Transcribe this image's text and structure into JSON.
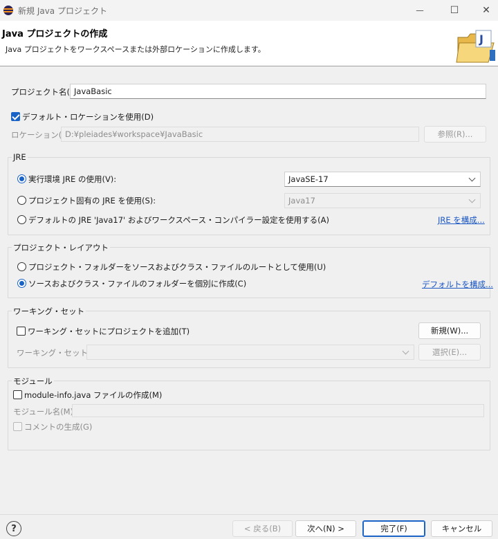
{
  "window": {
    "title": "新規 Java プロジェクト",
    "minimize_glyph": "—",
    "maximize_glyph": "☐",
    "close_glyph": "✕"
  },
  "header": {
    "title": "Java プロジェクトの作成",
    "description": "Java プロジェクトをワークスペースまたは外部ロケーションに作成します。",
    "icon": "folder-icon"
  },
  "project": {
    "name_label": "プロジェクト名(P):",
    "name_value": "JavaBasic",
    "default_location_label": "デフォルト・ロケーションを使用(D)",
    "default_location_checked": true,
    "location_label": "ロケーション(L):",
    "location_value": "D:¥pleiades¥workspace¥JavaBasic",
    "browse_label": "参照(R)..."
  },
  "jre": {
    "group_title": "JRE",
    "option_env_label": "実行環境 JRE の使用(V):",
    "option_env_value": "JavaSE-17",
    "option_project_label": "プロジェクト固有の JRE を使用(S):",
    "option_project_value": "Java17",
    "option_default_label": "デフォルトの JRE 'Java17' およびワークスペース・コンパイラー設定を使用する(A)",
    "configure_link": "JRE を構成...",
    "selected": "env"
  },
  "layout": {
    "group_title": "プロジェクト・レイアウト",
    "option_root_label": "プロジェクト・フォルダーをソースおよびクラス・ファイルのルートとして使用(U)",
    "option_separate_label": "ソースおよびクラス・ファイルのフォルダーを個別に作成(C)",
    "configure_link": "デフォルトを構成...",
    "selected": "separate"
  },
  "working_set": {
    "group_title": "ワーキング・セット",
    "add_label": "ワーキング・セットにプロジェクトを追加(T)",
    "add_checked": false,
    "new_button": "新規(W)...",
    "sets_label": "ワーキング・セット(O):",
    "sets_value": "",
    "select_button": "選択(E)..."
  },
  "module": {
    "group_title": "モジュール",
    "create_label": "module-info.java ファイルの作成(M)",
    "create_checked": false,
    "name_label": "モジュール名(M):",
    "name_value": "",
    "comments_label": "コメントの生成(G)"
  },
  "footer": {
    "help_glyph": "?",
    "back_button": "< 戻る(B)",
    "next_button": "次へ(N) >",
    "finish_button": "完了(F)",
    "cancel_button": "キャンセル"
  }
}
